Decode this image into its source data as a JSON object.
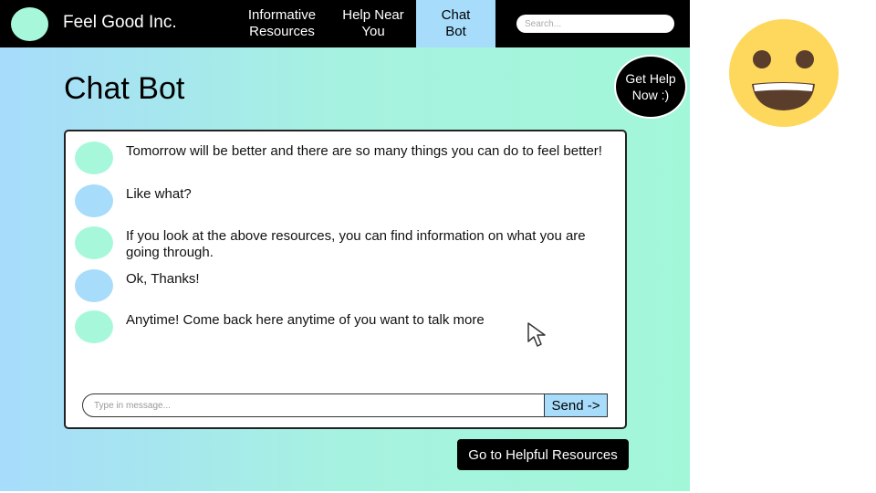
{
  "navbar": {
    "brand": "Feel Good Inc.",
    "links": [
      {
        "label": "Informative\nResources"
      },
      {
        "label": "Help Near\nYou"
      },
      {
        "label": "Chat\nBot"
      }
    ],
    "search_placeholder": "Search..."
  },
  "page": {
    "title": "Chat Bot",
    "get_help_label": "Get Help\nNow :)"
  },
  "chat": {
    "messages": [
      {
        "sender": "bot",
        "text": "Tomorrow will be better and there are so many things you can do to feel better!"
      },
      {
        "sender": "user",
        "text": "Like what?"
      },
      {
        "sender": "bot",
        "text": "If you look at the above resources, you can find information on what you are going through."
      },
      {
        "sender": "user",
        "text": "Ok, Thanks!"
      },
      {
        "sender": "bot",
        "text": "Anytime! Come back here anytime of you want to talk more"
      }
    ],
    "input_placeholder": "Type in message...",
    "send_label": "Send ->"
  },
  "footer": {
    "resources_button_label": "Go to Helpful Resources"
  },
  "icons": {
    "cursor": "cursor-arrow-icon",
    "decoration": "grinning-face-icon"
  },
  "colors": {
    "nav_bg": "#000000",
    "active_tab": "#a7dcfb",
    "bot_avatar": "#a7f8da",
    "user_avatar": "#a7dcfb",
    "smiley": "#fdd85d"
  }
}
